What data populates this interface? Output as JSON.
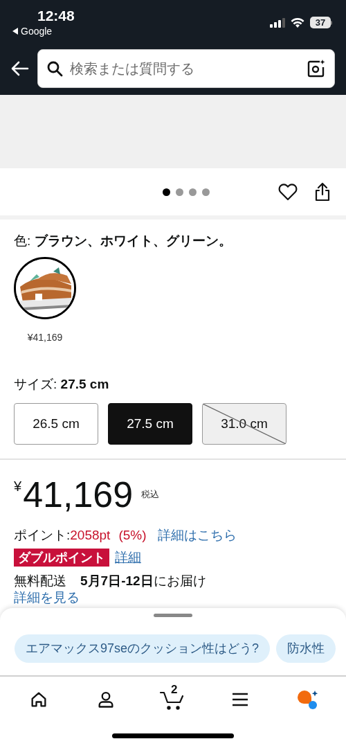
{
  "status_bar": {
    "time": "12:48",
    "back_label": "Google",
    "battery": "37"
  },
  "search": {
    "placeholder": "検索または質問する"
  },
  "gallery": {
    "dots": [
      {
        "selected": true
      },
      {
        "selected": false
      },
      {
        "selected": false
      },
      {
        "selected": false
      }
    ]
  },
  "color": {
    "label": "色: ",
    "value": "ブラウン、ホワイト、グリーン。",
    "swatches": [
      {
        "price": "¥41,169",
        "selected": true
      }
    ]
  },
  "size": {
    "label": "サイズ: ",
    "value": "27.5 cm",
    "options": [
      {
        "label": "26.5 cm",
        "selected": false,
        "available": true
      },
      {
        "label": "27.5 cm",
        "selected": true,
        "available": true
      },
      {
        "label": "31.0 cm",
        "selected": false,
        "available": false
      }
    ]
  },
  "price": {
    "symbol": "¥",
    "amount": "41,169",
    "tax": "税込"
  },
  "points": {
    "label": "ポイント: ",
    "value": "2058pt",
    "percent": "(5%)",
    "link": "詳細はこちら"
  },
  "double_point": {
    "badge": "ダブルポイント",
    "link": "詳細"
  },
  "delivery": {
    "label": "無料配送",
    "dates": "5月7日-12日",
    "suffix": "にお届け",
    "link": "詳細を見る"
  },
  "sheet": {
    "chips": [
      "エアマックス97seのクッション性はどう?",
      "防水性"
    ]
  },
  "nav": {
    "items": [
      {
        "kind": "home"
      },
      {
        "kind": "account"
      },
      {
        "kind": "cart",
        "badge": "2"
      },
      {
        "kind": "menu"
      },
      {
        "kind": "assistant"
      }
    ]
  }
}
